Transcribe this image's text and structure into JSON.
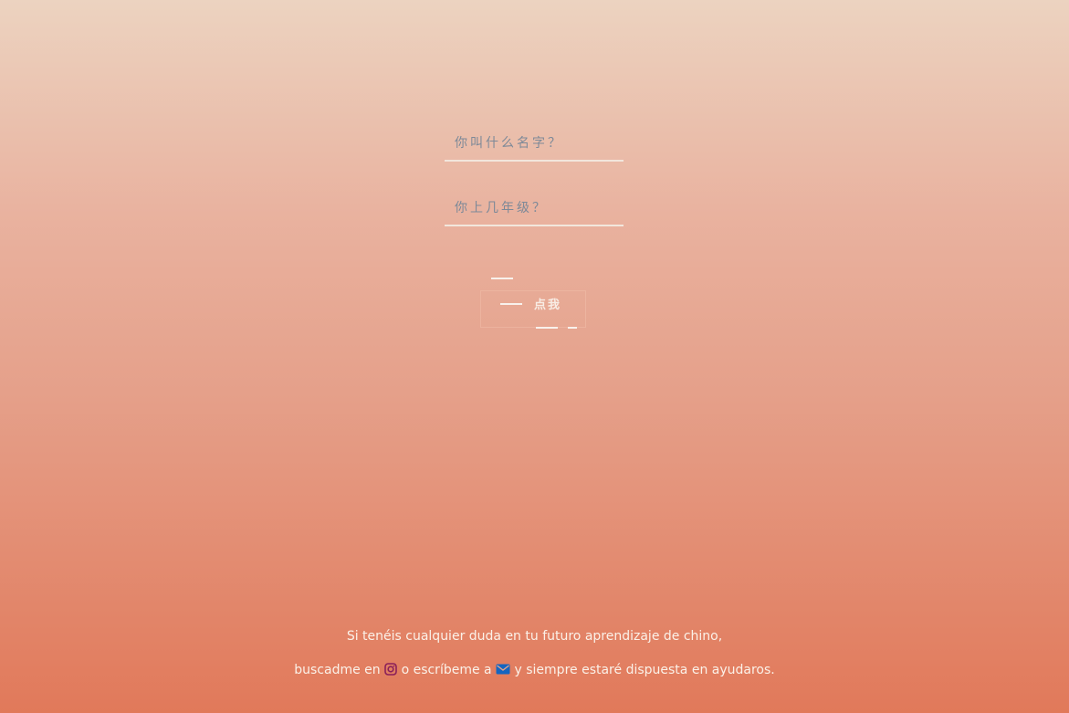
{
  "form": {
    "name_placeholder": "你叫什么名字？",
    "grade_placeholder": "你上几年级？",
    "submit_label": "点我"
  },
  "footer": {
    "line1": "Si tenéis cualquier duda en tu futuro aprendizaje de chino,",
    "line2_prefix": "buscadme en",
    "line2_middle": "o escríbeme a",
    "line2_suffix": "y siempre estaré dispuesta en ayudaros.",
    "instagram_icon": "instagram-icon",
    "email_icon": "envelope-icon"
  },
  "colors": {
    "gradient_top": "#ecd3c0",
    "gradient_bottom": "#e1795a",
    "instagram": "#8a1f5a",
    "email": "#1565c0",
    "text_light": "#fbf1e8"
  }
}
